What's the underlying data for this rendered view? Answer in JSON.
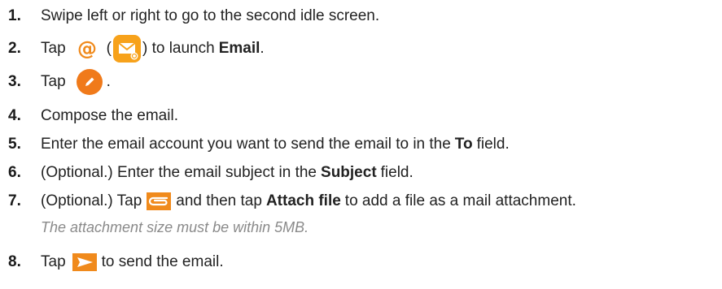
{
  "steps": [
    {
      "num": "1.",
      "text": "Swipe left or right to go to the second idle screen."
    },
    {
      "num": "2.",
      "pre": "Tap",
      "open_paren": "(",
      "mid": ") to launch",
      "bold": "Email",
      "post": ".",
      "icon1": "email-at-icon",
      "icon2": "email-envelope-app-icon"
    },
    {
      "num": "3.",
      "pre": "Tap",
      "post": ".",
      "icon": "compose-pencil-icon"
    },
    {
      "num": "4.",
      "text": "Compose the email."
    },
    {
      "num": "5.",
      "pre": "Enter the email account you want to send the email to in the",
      "bold": "To",
      "post": "field."
    },
    {
      "num": "6.",
      "pre": "(Optional.) Enter the email subject in the",
      "bold": "Subject",
      "post": "field."
    },
    {
      "num": "7.",
      "pre": "(Optional.) Tap",
      "mid": "and then tap",
      "bold": "Attach file",
      "post": "to add a file as a mail attachment.",
      "icon": "paperclip-icon",
      "note": "The attachment size must be within 5MB."
    },
    {
      "num": "8.",
      "pre": "Tap",
      "post": "to send the email.",
      "icon": "send-arrow-icon"
    }
  ],
  "colors": {
    "accent_orange": "#F08A1C",
    "send_orange": "#F07A1A",
    "text": "#222222",
    "note": "#8A8A8A"
  }
}
